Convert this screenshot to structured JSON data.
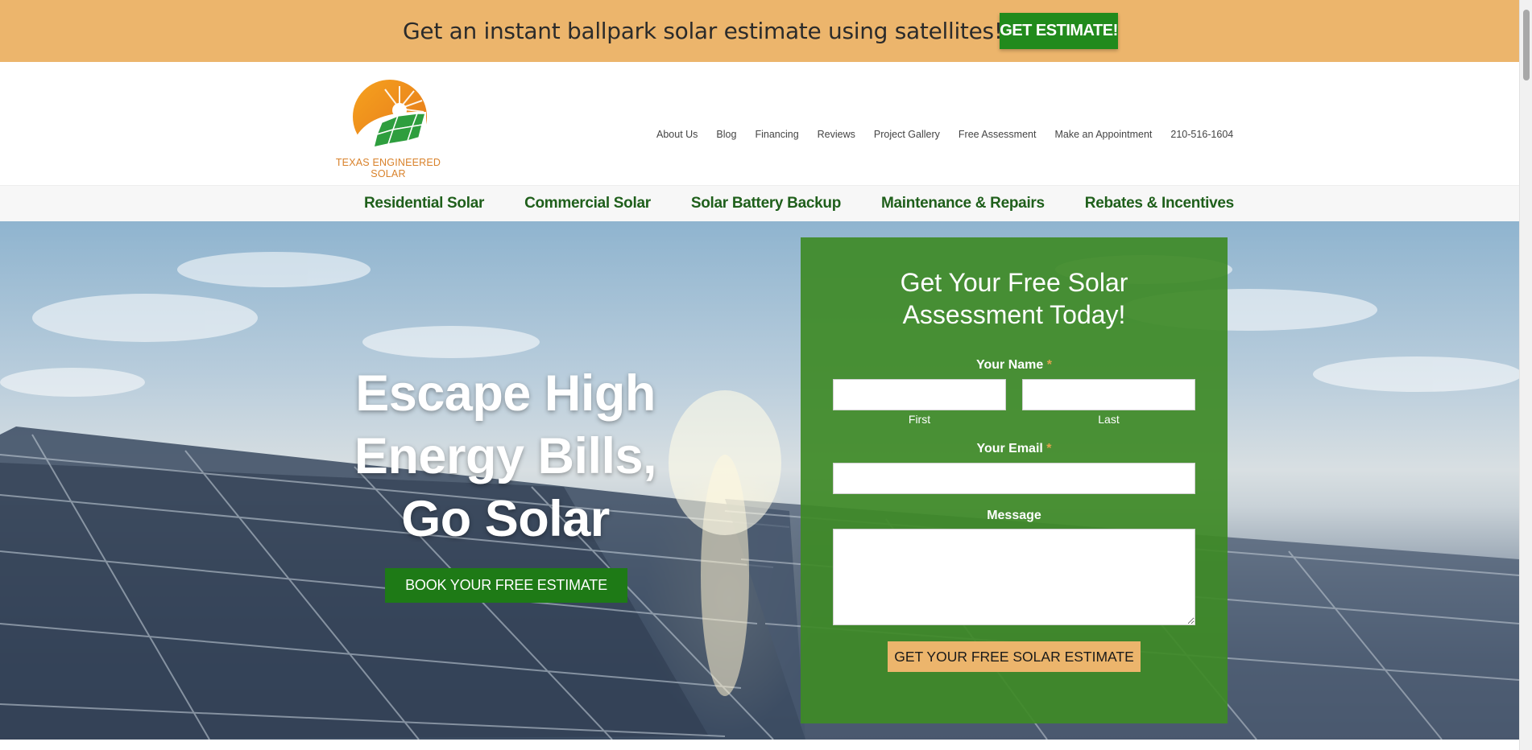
{
  "promo": {
    "text": "Get an instant ballpark solar estimate using satellites!",
    "button": "GET ESTIMATE!"
  },
  "logo": {
    "text": "TEXAS ENGINEERED SOLAR",
    "icon": "sun-solar-panel-logo-icon"
  },
  "top_nav": [
    "About Us",
    "Blog",
    "Financing",
    "Reviews",
    "Project Gallery",
    "Free Assessment",
    "Make an Appointment",
    "210-516-1604"
  ],
  "main_nav": [
    "Residential Solar",
    "Commercial Solar",
    "Solar Battery Backup",
    "Maintenance & Repairs",
    "Rebates & Incentives"
  ],
  "hero": {
    "headline_line1": "Escape High",
    "headline_line2": "Energy Bills,",
    "headline_line3": "Go Solar",
    "button": "BOOK YOUR FREE ESTIMATE"
  },
  "form": {
    "title_line1": "Get Your Free Solar",
    "title_line2": "Assessment Today!",
    "name_label": "Your Name",
    "required_mark": "*",
    "first_label": "First",
    "last_label": "Last",
    "email_label": "Your Email",
    "message_label": "Message",
    "submit": "GET YOUR FREE SOLAR ESTIMATE"
  },
  "colors": {
    "promo_bg": "#ecb56c",
    "brand_green": "#218a1c",
    "nav_green": "#1f5f1b",
    "form_green": "#3e8a26",
    "logo_orange": "#d9822b"
  }
}
